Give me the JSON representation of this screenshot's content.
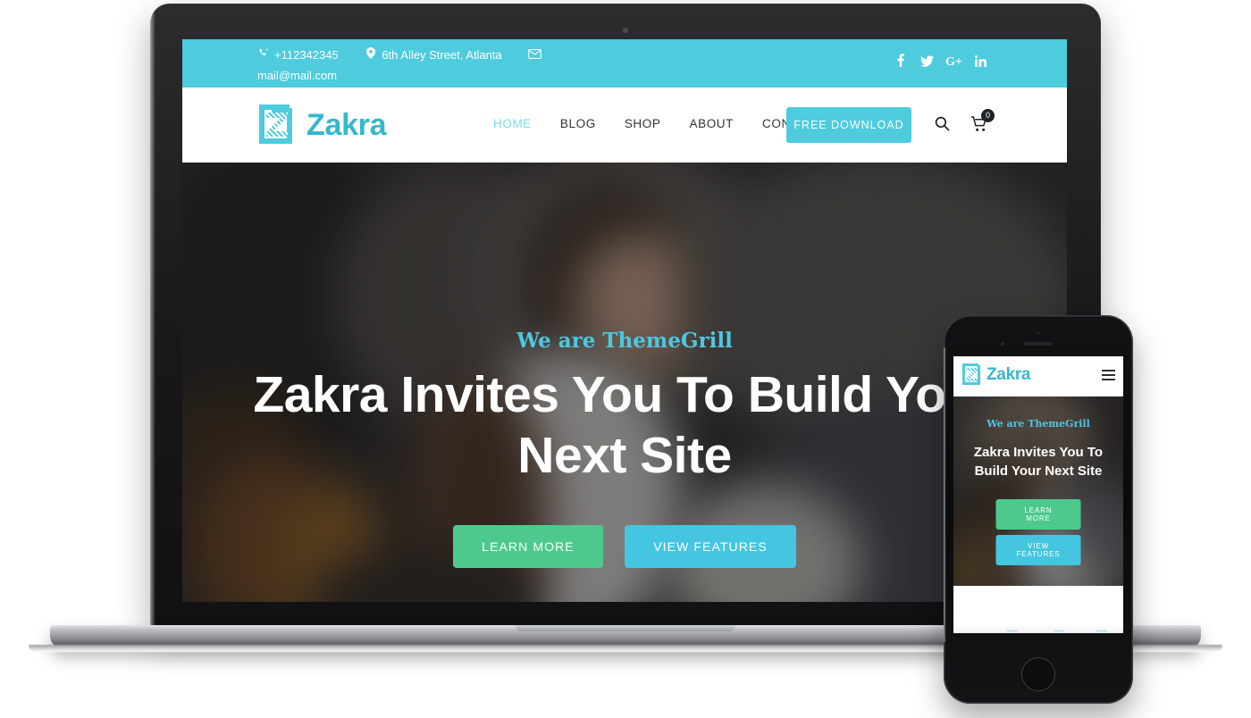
{
  "topbar": {
    "phone": "+112342345",
    "address": "6th Alley Street, Atlanta",
    "email": "mail@mail.com",
    "bg_color": "#4ecbdd",
    "social": [
      {
        "name": "facebook",
        "glyph": "f"
      },
      {
        "name": "twitter",
        "glyph": "t"
      },
      {
        "name": "google-plus",
        "glyph": "G+"
      },
      {
        "name": "linkedin",
        "glyph": "in"
      }
    ]
  },
  "nav": {
    "brand": "Zakra",
    "brand_color": "#36b7cc",
    "menu": [
      {
        "label": "HOME",
        "active": true
      },
      {
        "label": "BLOG",
        "active": false
      },
      {
        "label": "SHOP",
        "active": false
      },
      {
        "label": "ABOUT",
        "active": false
      },
      {
        "label": "CONTACT",
        "active": false
      }
    ],
    "cta_label": "FREE DOWNLOAD",
    "cart_count": "0"
  },
  "hero": {
    "subtitle": "We are ThemeGrill",
    "title": "Zakra Invites You To Build Your Next Site",
    "primary_button": "LEARN MORE",
    "secondary_button": "VIEW FEATURES",
    "primary_color": "#4ec98e",
    "secondary_color": "#45c6e0",
    "subtitle_color": "#4ec7e0"
  },
  "phone": {
    "brand": "Zakra",
    "subtitle": "We are ThemeGrill",
    "title": "Zakra Invites You To Build Your Next Site",
    "primary_button": "LEARN MORE",
    "secondary_button": "VIEW FEATURES"
  }
}
